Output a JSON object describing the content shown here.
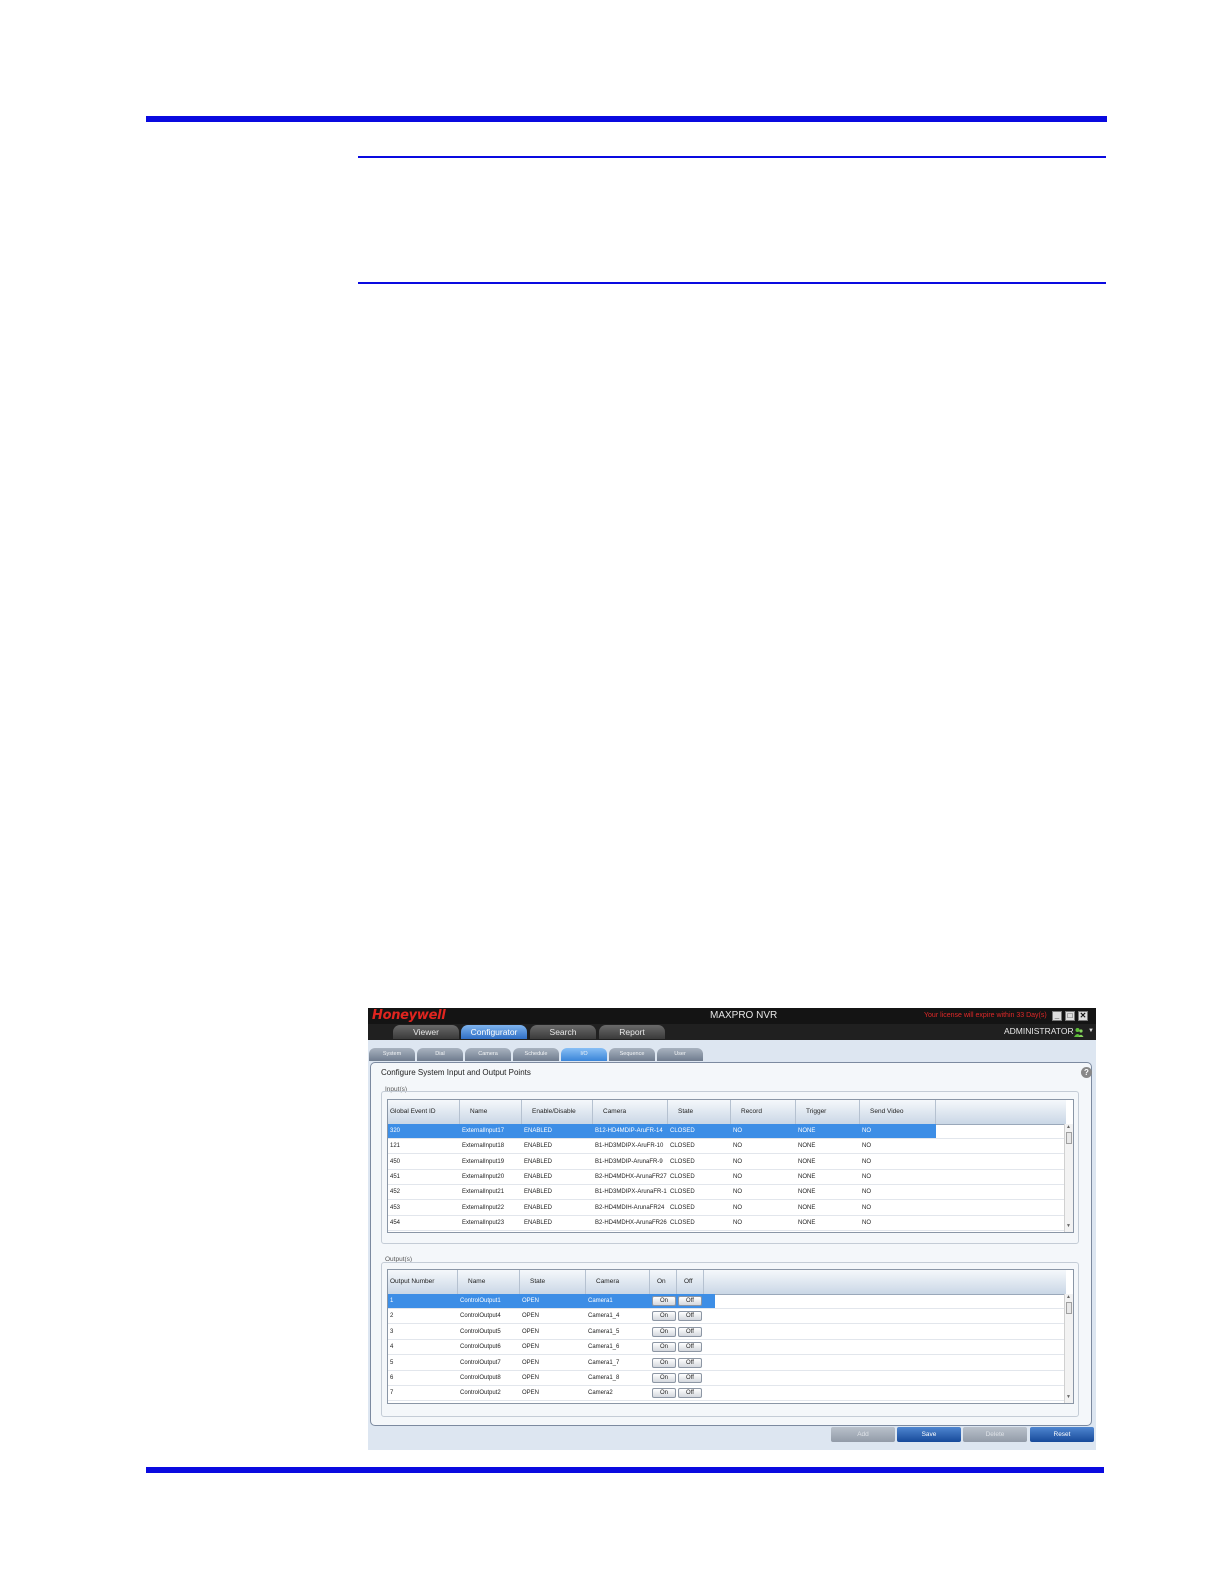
{
  "app": {
    "logo": "Honeywell",
    "title": "MAXPRO NVR",
    "license_notice": "Your license will expire within 33 Day(s)",
    "user": "ADMINISTRATOR"
  },
  "nav_tabs": [
    {
      "label": "Viewer",
      "active": false
    },
    {
      "label": "Configurator",
      "active": true
    },
    {
      "label": "Search",
      "active": false
    },
    {
      "label": "Report",
      "active": false
    }
  ],
  "sub_tabs": [
    {
      "label": "System",
      "active": false
    },
    {
      "label": "Dial",
      "active": false
    },
    {
      "label": "Camera",
      "active": false
    },
    {
      "label": "Schedule",
      "active": false
    },
    {
      "label": "I/O",
      "active": true
    },
    {
      "label": "Sequence",
      "active": false
    },
    {
      "label": "User",
      "active": false
    }
  ],
  "panel": {
    "title": "Configure System Input and Output Points",
    "help_icon": "question-mark-icon"
  },
  "inputs": {
    "legend": "Input(s)",
    "columns": [
      "Global Event ID",
      "Name",
      "Enable/Disable",
      "Camera",
      "State",
      "Record",
      "Trigger",
      "Send Video"
    ],
    "rows": [
      [
        "320",
        "ExternalInput17",
        "ENABLED",
        "B12-HD4MDIP-AruFR-14",
        "CLOSED",
        "NO",
        "NONE",
        "NO"
      ],
      [
        "121",
        "ExternalInput18",
        "ENABLED",
        "B1-HD3MDIPX-AruFR-10",
        "CLOSED",
        "NO",
        "NONE",
        "NO"
      ],
      [
        "450",
        "ExternalInput19",
        "ENABLED",
        "B1-HD3MDIP-ArunaFR-9",
        "CLOSED",
        "NO",
        "NONE",
        "NO"
      ],
      [
        "451",
        "ExternalInput20",
        "ENABLED",
        "B2-HD4MDHX-ArunaFR27",
        "CLOSED",
        "NO",
        "NONE",
        "NO"
      ],
      [
        "452",
        "ExternalInput21",
        "ENABLED",
        "B1-HD3MDIPX-ArunaFR-1",
        "CLOSED",
        "NO",
        "NONE",
        "NO"
      ],
      [
        "453",
        "ExternalInput22",
        "ENABLED",
        "B2-HD4MDIH-ArunaFR24",
        "CLOSED",
        "NO",
        "NONE",
        "NO"
      ],
      [
        "454",
        "ExternalInput23",
        "ENABLED",
        "B2-HD4MDHX-ArunaFR26",
        "CLOSED",
        "NO",
        "NONE",
        "NO"
      ]
    ]
  },
  "outputs": {
    "legend": "Output(s)",
    "columns": [
      "Output Number",
      "Name",
      "State",
      "Camera",
      "On",
      "Off"
    ],
    "on_label": "On",
    "off_label": "Off",
    "rows": [
      [
        "1",
        "ControlOutput1",
        "OPEN",
        "Camera1"
      ],
      [
        "2",
        "ControlOutput4",
        "OPEN",
        "Camera1_4"
      ],
      [
        "3",
        "ControlOutput5",
        "OPEN",
        "Camera1_5"
      ],
      [
        "4",
        "ControlOutput6",
        "OPEN",
        "Camera1_6"
      ],
      [
        "5",
        "ControlOutput7",
        "OPEN",
        "Camera1_7"
      ],
      [
        "6",
        "ControlOutput8",
        "OPEN",
        "Camera1_8"
      ],
      [
        "7",
        "ControlOutput2",
        "OPEN",
        "Camera2"
      ]
    ]
  },
  "buttons": [
    {
      "label": "Add",
      "enabled": false
    },
    {
      "label": "Save",
      "enabled": true
    },
    {
      "label": "Delete",
      "enabled": false
    },
    {
      "label": "Reset",
      "enabled": true
    }
  ],
  "colors": {
    "rule": "#0a0ae0",
    "selection": "#3d8ee6",
    "active_tab": "#2f6fc6",
    "license_text": "#e02828"
  }
}
